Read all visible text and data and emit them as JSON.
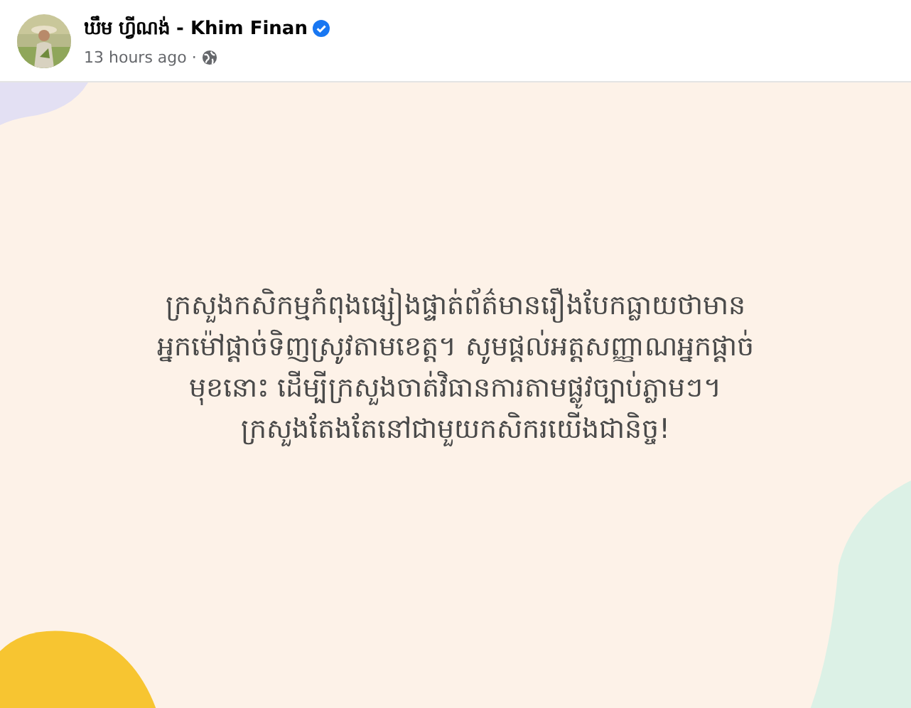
{
  "post": {
    "author": "ឃឹម ហ្វីណង់ - Khim Finan",
    "verified": true,
    "time": "13 hours ago ·"
  },
  "card": {
    "text": "ក្រសួងកសិកម្មកំពុងផ្សៀងផ្ទាត់ព័ត៌មានរឿងបែកធ្លាយថាមាន\nអ្នកម៉ៅផ្ដាច់ទិញស្រូវតាមខេត្ត។ សូមផ្ដល់អត្តសញ្ញាណអ្នកផ្ដាច់\nមុខនោះ ដើម្បីក្រសួងចាត់វិធានការតាមផ្លូវច្បាប់ភ្លាមៗ។\nក្រសួងតែងតែនៅជាមួយកសិករយើងជានិច្ច!"
  }
}
